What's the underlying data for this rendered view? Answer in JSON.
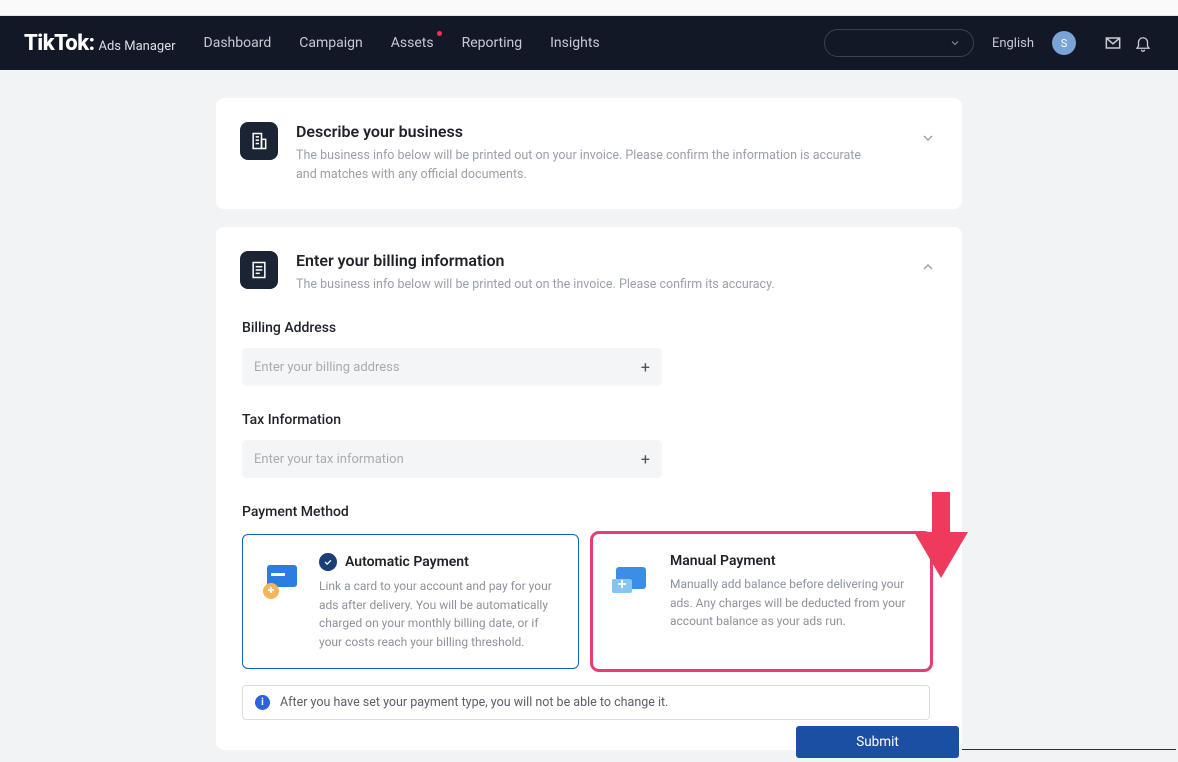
{
  "brand": {
    "logo": "TikTok:",
    "sub": "Ads Manager"
  },
  "nav": {
    "items": [
      "Dashboard",
      "Campaign",
      "Assets",
      "Reporting",
      "Insights"
    ],
    "dot_index": 2,
    "language": "English",
    "avatar_initial": "S"
  },
  "describe": {
    "title": "Describe your business",
    "desc": "The business info below will be printed out on your invoice. Please confirm the information is accurate and matches with any official documents."
  },
  "billing": {
    "title": "Enter your billing information",
    "desc": "The business info below will be printed out on the invoice. Please confirm its accuracy.",
    "address_label": "Billing Address",
    "address_placeholder": "Enter your billing address",
    "tax_label": "Tax Information",
    "tax_placeholder": "Enter your tax information",
    "pm_label": "Payment Method",
    "pm_auto": {
      "title": "Automatic Payment",
      "desc": "Link a card to your account and pay for your ads after delivery. You will be automatically charged on your monthly billing date, or if your costs reach your billing threshold."
    },
    "pm_manual": {
      "title": "Manual Payment",
      "desc": "Manually add balance before delivering your ads. Any charges will be deducted from your account balance as your ads run."
    },
    "info": "After you have set your payment type, you will not be able to change it."
  },
  "submit": "Submit"
}
